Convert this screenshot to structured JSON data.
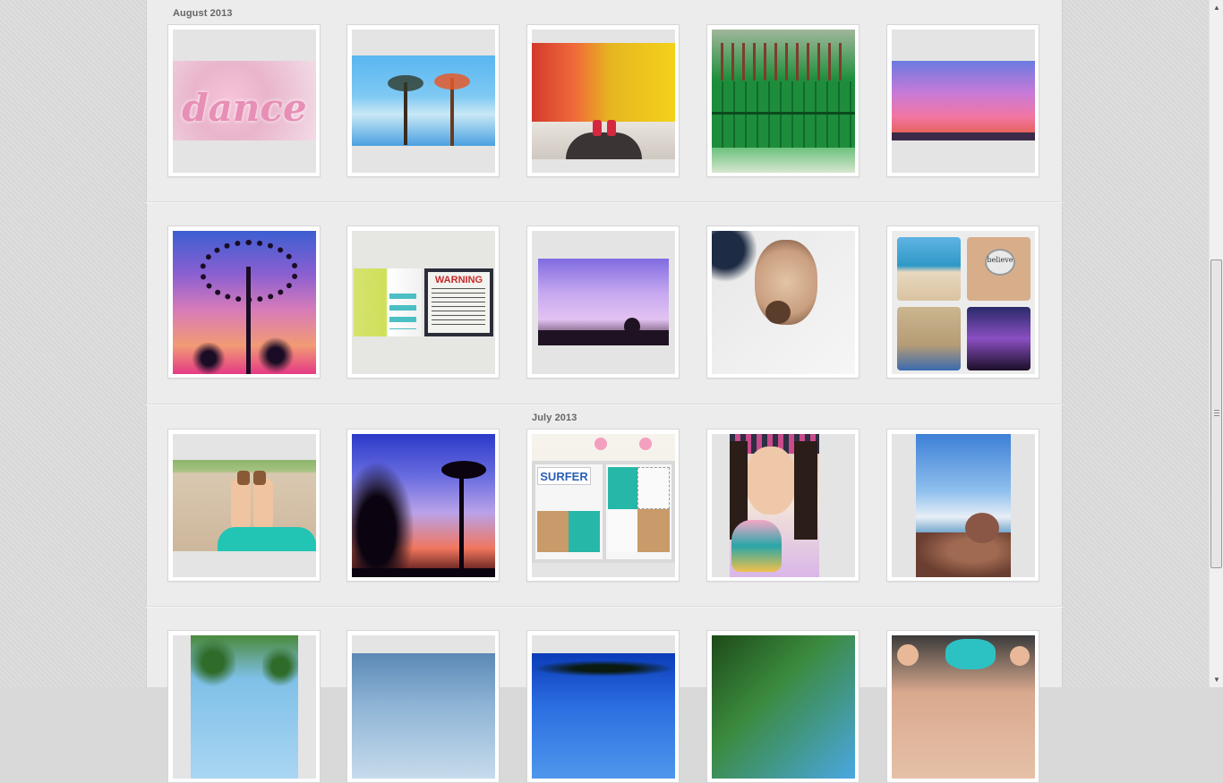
{
  "sections": [
    {
      "label": "August 2013"
    },
    {
      "label": "July 2013"
    }
  ],
  "photos": [
    {
      "name": "photo-dance-glitter",
      "caption": "dance"
    },
    {
      "name": "photo-palm-trees"
    },
    {
      "name": "photo-flowers-sneakers"
    },
    {
      "name": "photo-green-cans"
    },
    {
      "name": "photo-pink-sunset"
    },
    {
      "name": "photo-tree-silhouette"
    },
    {
      "name": "photo-bows-warning"
    },
    {
      "name": "photo-purple-dusk"
    },
    {
      "name": "photo-siamese-cat"
    },
    {
      "name": "photo-collage",
      "caption": "believe"
    },
    {
      "name": "photo-legs-beach"
    },
    {
      "name": "photo-palm-silhouette"
    },
    {
      "name": "photo-surfer-board",
      "caption": "SURFER"
    },
    {
      "name": "photo-girl-selfie"
    },
    {
      "name": "photo-beach-rocks"
    },
    {
      "name": "photo-leaves-sky"
    },
    {
      "name": "photo-cloudy-sky"
    },
    {
      "name": "photo-blue-sky-trees"
    },
    {
      "name": "photo-greenery-sky"
    },
    {
      "name": "photo-girl-bow"
    }
  ],
  "warning_sign": {
    "title": "WARNING"
  },
  "icons": {
    "scroll_up": "up-arrow-icon",
    "scroll_down": "down-arrow-icon"
  }
}
